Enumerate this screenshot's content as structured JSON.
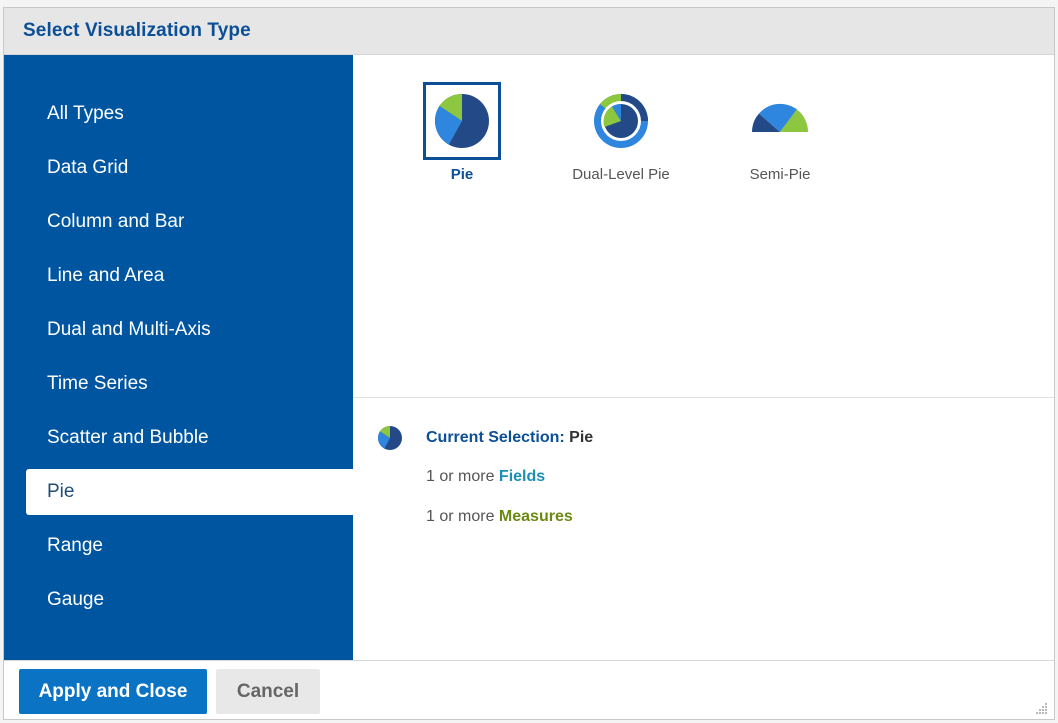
{
  "dialog": {
    "title": "Select Visualization Type"
  },
  "sidebar": {
    "collapse_glyph": "‹",
    "items": [
      {
        "label": "All Types",
        "active": false
      },
      {
        "label": "Data Grid",
        "active": false
      },
      {
        "label": "Column and Bar",
        "active": false
      },
      {
        "label": "Line and Area",
        "active": false
      },
      {
        "label": "Dual and Multi-Axis",
        "active": false
      },
      {
        "label": "Time Series",
        "active": false
      },
      {
        "label": "Scatter and Bubble",
        "active": false
      },
      {
        "label": "Pie",
        "active": true
      },
      {
        "label": "Range",
        "active": false
      },
      {
        "label": "Gauge",
        "active": false
      }
    ]
  },
  "gallery": {
    "items": [
      {
        "label": "Pie",
        "icon": "pie-chart-icon",
        "selected": true
      },
      {
        "label": "Dual-Level Pie",
        "icon": "dual-level-pie-icon",
        "selected": false
      },
      {
        "label": "Semi-Pie",
        "icon": "semi-pie-icon",
        "selected": false
      }
    ]
  },
  "details": {
    "current_label": "Current Selection:",
    "current_value": "Pie",
    "fields_prefix": "1 or more",
    "fields_word": "Fields",
    "measures_prefix": "1 or more",
    "measures_word": "Measures"
  },
  "footer": {
    "apply_label": "Apply and Close",
    "cancel_label": "Cancel"
  },
  "colors": {
    "sidebar_bg": "#0055a0",
    "primary_button": "#0a73c4",
    "title_text": "#0b4f96",
    "pie_dark": "#234a86",
    "pie_mid": "#2e86de",
    "pie_green": "#8dc63f"
  }
}
